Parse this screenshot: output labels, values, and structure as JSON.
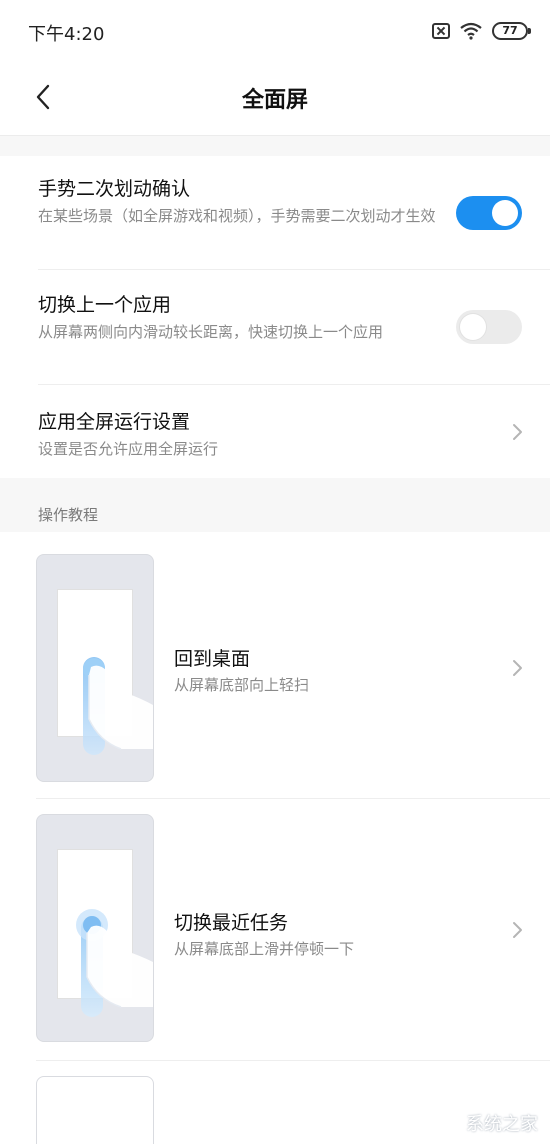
{
  "status_bar": {
    "time": "下午4:20",
    "battery": "77",
    "icons": [
      "sim-off-icon",
      "wifi-icon",
      "battery-icon"
    ]
  },
  "header": {
    "title": "全面屏",
    "back_icon": "chevron-left-icon"
  },
  "settings": [
    {
      "title": "手势二次划动确认",
      "desc": "在某些场景（如全屏游戏和视频），手势需要二次划动才生效",
      "control": "toggle",
      "on": true
    },
    {
      "title": "切换上一个应用",
      "desc": "从屏幕两侧向内滑动较长距离，快速切换上一个应用",
      "control": "toggle",
      "on": false
    },
    {
      "title": "应用全屏运行设置",
      "desc": "设置是否允许应用全屏运行",
      "control": "chevron"
    }
  ],
  "tutorial": {
    "header": "操作教程",
    "items": [
      {
        "title": "回到桌面",
        "desc": "从屏幕底部向上轻扫"
      },
      {
        "title": "切换最近任务",
        "desc": "从屏幕底部上滑并停顿一下"
      }
    ]
  },
  "watermark": "系统之家",
  "colors": {
    "accent": "#1c8ff0",
    "toggle_off": "#ebebeb",
    "secondary_text": "#8a8a8a",
    "page_bg": "#f7f7f7"
  }
}
